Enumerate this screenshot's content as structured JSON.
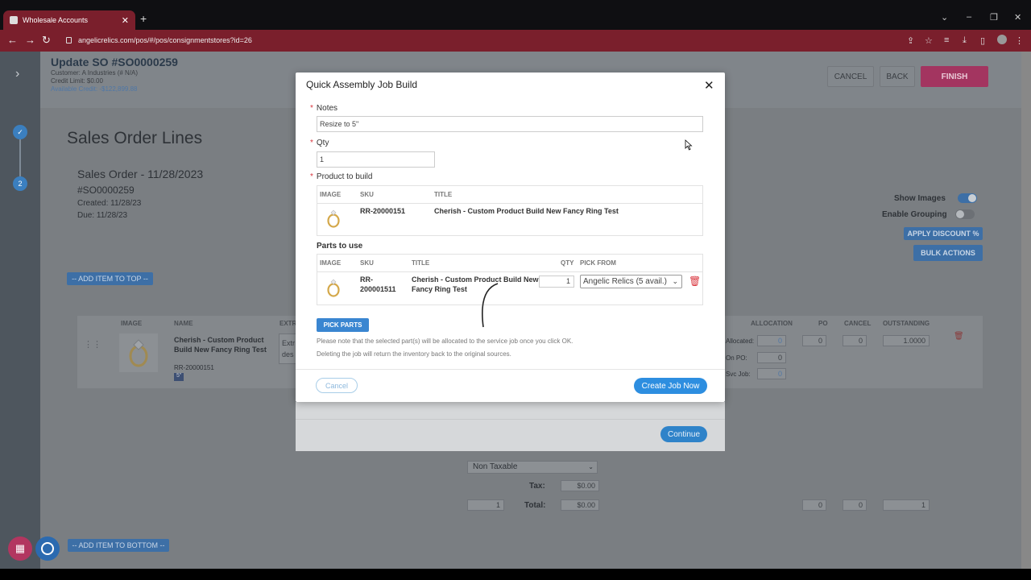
{
  "browser": {
    "tab_title": "Wholesale Accounts",
    "url": "angelicrelics.com/pos/#/pos/consignmentstores?id=26"
  },
  "header": {
    "title": "Update SO #SO0000259",
    "customer": "Customer: A Industries (# N/A)",
    "credit_limit": "Credit Limit: $0.00",
    "available_credit": "Available Credit: -$122,899.88",
    "cancel_label": "CANCEL",
    "back_label": "BACK",
    "finish_label": "FINISH"
  },
  "steps": [
    "2"
  ],
  "page": {
    "section_title": "Sales Order Lines",
    "order_title": "Sales Order - 11/28/2023",
    "order_number": "#SO0000259",
    "created": "Created: 11/28/23",
    "due": "Due: 11/28/23",
    "show_images": "Show Images",
    "enable_grouping": "Enable Grouping",
    "apply_discount": "APPLY DISCOUNT %",
    "bulk_actions": "BULK ACTIONS",
    "add_top": "-- ADD ITEM TO TOP --",
    "add_bottom": "-- ADD ITEM TO BOTTOM --",
    "columns": {
      "image": "IMAGE",
      "name": "NAME",
      "extra": "EXTR",
      "allocation": "ALLOCATION",
      "po": "PO",
      "cancel": "CANCEL",
      "outstanding": "OUTSTANDING"
    },
    "line": {
      "name": "Cherish - Custom Product Build New Fancy Ring Test",
      "sku": "RR-20000151",
      "size_badge": "5\"",
      "extra": "Extr",
      "extra2": "des",
      "allocated": "Allocated:",
      "allocated_val": "0",
      "on_po": "On PO:",
      "on_po_val": "0",
      "svc_job": "Svc Job:",
      "svc_job_val": "0",
      "po_val": "0",
      "cancel_val": "0",
      "outstanding_val": "1.0000"
    },
    "tax_select": "Non Taxable",
    "tax_label": "Tax:",
    "tax_val": "$0.00",
    "total_qty": "1",
    "total_label": "Total:",
    "total_val": "$0.00",
    "sum_po": "0",
    "sum_cancel": "0",
    "sum_outstanding": "1"
  },
  "modal": {
    "title": "Quick Assembly Job Build",
    "notes_label": "Notes",
    "notes_value": "Resize to 5\"",
    "qty_label": "Qty",
    "qty_value": "1",
    "product_label": "Product to build",
    "product_cols": {
      "image": "IMAGE",
      "sku": "SKU",
      "title": "TITLE"
    },
    "product": {
      "sku": "RR-20000151",
      "title": "Cherish - Custom Product Build New Fancy Ring Test"
    },
    "parts_label": "Parts to use",
    "parts_cols": {
      "image": "IMAGE",
      "sku": "SKU",
      "title": "TITLE",
      "qty": "QTY",
      "pick_from": "PICK FROM"
    },
    "part": {
      "sku_line1": "RR-",
      "sku_line2": "200001511",
      "title_line1": "Cherish - Custom Product Build New",
      "title_line2": "Fancy Ring Test",
      "qty": "1",
      "pick_from": "Angelic Relics (5 avail.)"
    },
    "pick_parts": "PICK PARTS",
    "note1": "Please note that the selected part(s) will be allocated to the service job once you click OK.",
    "note2": "Deleting the job will return the inventory back to the original sources.",
    "cancel_label": "Cancel",
    "create_label": "Create Job Now",
    "continue_label": "Continue"
  },
  "colors": {
    "accent": "#2d8ee0",
    "finish": "#c2306a",
    "chrome": "#7a1f2c"
  }
}
